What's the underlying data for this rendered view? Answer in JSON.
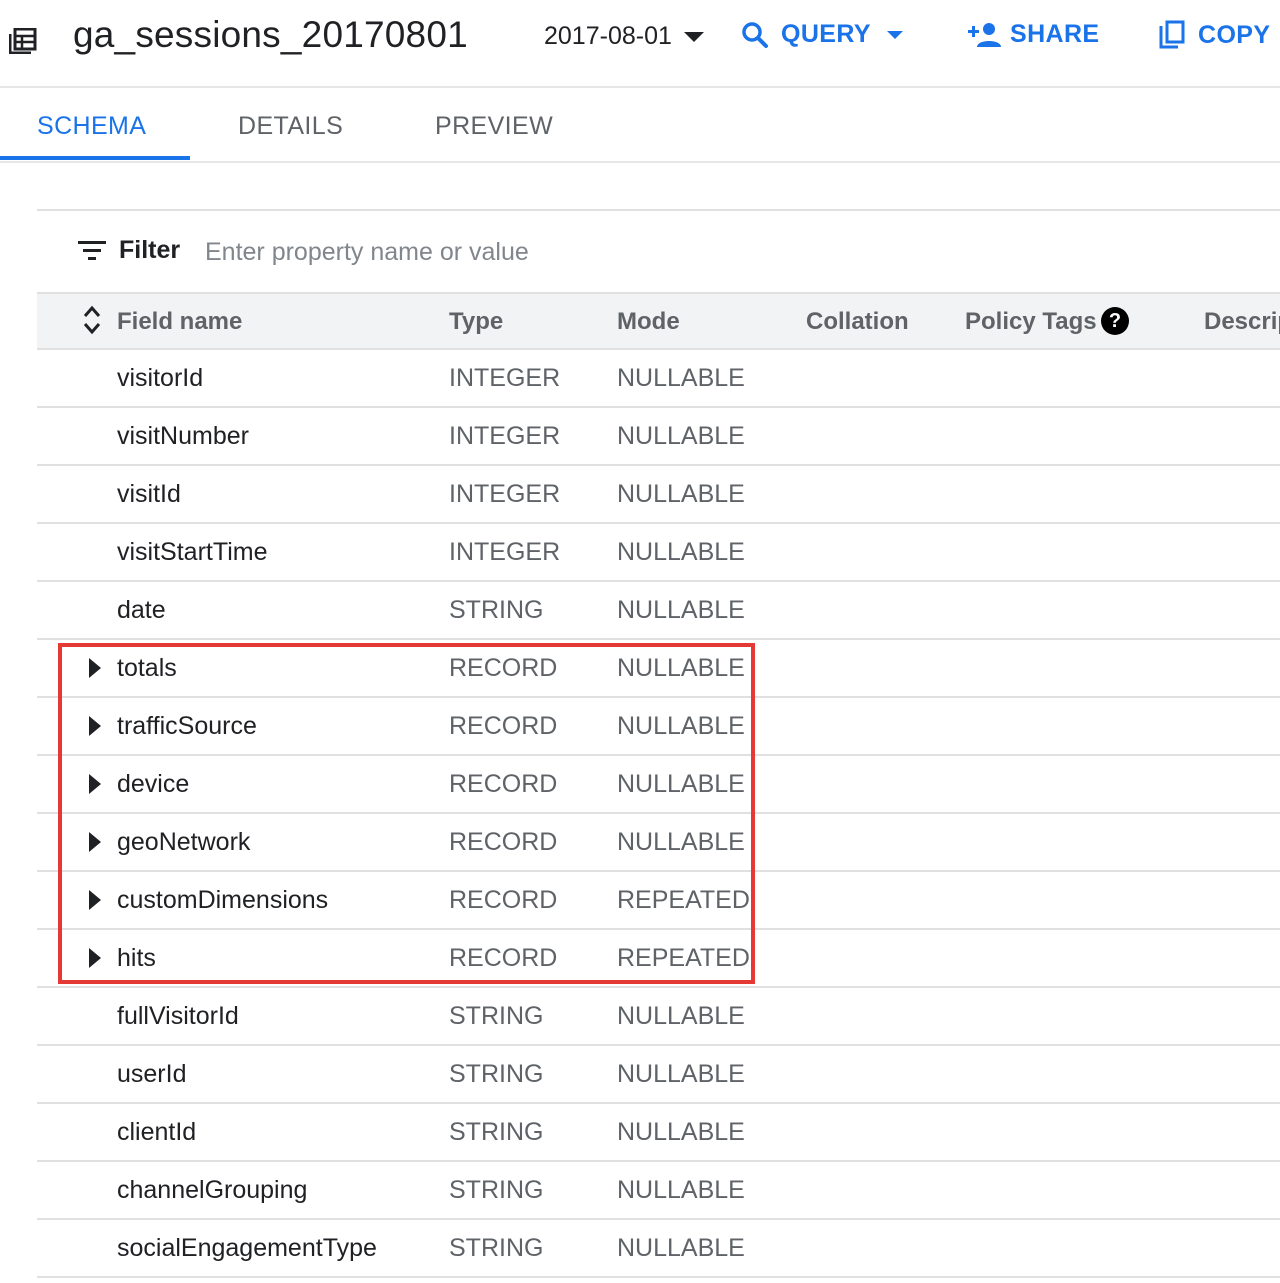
{
  "header": {
    "title": "ga_sessions_20170801",
    "date": "2017-08-01",
    "actions": {
      "query": "QUERY",
      "share": "SHARE",
      "copy": "COPY"
    }
  },
  "tabs": [
    {
      "label": "SCHEMA",
      "active": true
    },
    {
      "label": "DETAILS",
      "active": false
    },
    {
      "label": "PREVIEW",
      "active": false
    }
  ],
  "filter": {
    "label": "Filter",
    "placeholder": "Enter property name or value"
  },
  "table": {
    "columns": {
      "field_name": "Field name",
      "type": "Type",
      "mode": "Mode",
      "collation": "Collation",
      "policy_tags": "Policy Tags",
      "description": "Descrip"
    },
    "rows": [
      {
        "name": "visitorId",
        "type": "INTEGER",
        "mode": "NULLABLE",
        "expandable": false
      },
      {
        "name": "visitNumber",
        "type": "INTEGER",
        "mode": "NULLABLE",
        "expandable": false
      },
      {
        "name": "visitId",
        "type": "INTEGER",
        "mode": "NULLABLE",
        "expandable": false
      },
      {
        "name": "visitStartTime",
        "type": "INTEGER",
        "mode": "NULLABLE",
        "expandable": false
      },
      {
        "name": "date",
        "type": "STRING",
        "mode": "NULLABLE",
        "expandable": false
      },
      {
        "name": "totals",
        "type": "RECORD",
        "mode": "NULLABLE",
        "expandable": true
      },
      {
        "name": "trafficSource",
        "type": "RECORD",
        "mode": "NULLABLE",
        "expandable": true
      },
      {
        "name": "device",
        "type": "RECORD",
        "mode": "NULLABLE",
        "expandable": true
      },
      {
        "name": "geoNetwork",
        "type": "RECORD",
        "mode": "NULLABLE",
        "expandable": true
      },
      {
        "name": "customDimensions",
        "type": "RECORD",
        "mode": "REPEATED",
        "expandable": true
      },
      {
        "name": "hits",
        "type": "RECORD",
        "mode": "REPEATED",
        "expandable": true
      },
      {
        "name": "fullVisitorId",
        "type": "STRING",
        "mode": "NULLABLE",
        "expandable": false
      },
      {
        "name": "userId",
        "type": "STRING",
        "mode": "NULLABLE",
        "expandable": false
      },
      {
        "name": "clientId",
        "type": "STRING",
        "mode": "NULLABLE",
        "expandable": false
      },
      {
        "name": "channelGrouping",
        "type": "STRING",
        "mode": "NULLABLE",
        "expandable": false
      },
      {
        "name": "socialEngagementType",
        "type": "STRING",
        "mode": "NULLABLE",
        "expandable": false
      }
    ]
  },
  "colors": {
    "accent": "#1a73e8",
    "highlight_border": "#e53935"
  }
}
